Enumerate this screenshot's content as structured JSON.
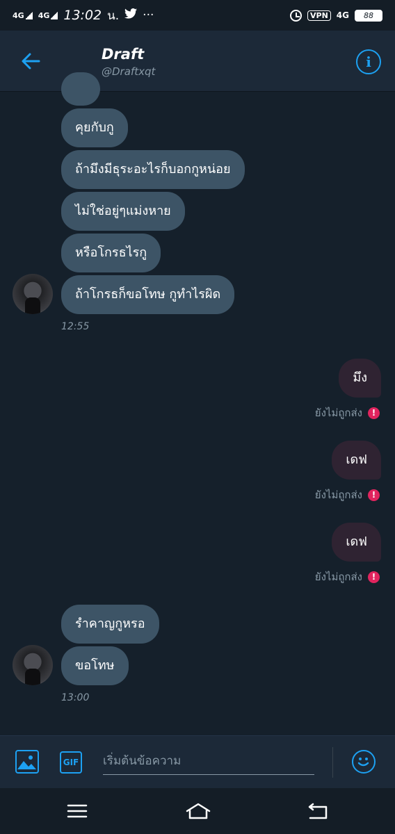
{
  "status_bar": {
    "signal_1": "4G",
    "signal_2": "4G",
    "time": "13:02",
    "carrier_suffix": "น.",
    "more": "···",
    "vpn": "VPN",
    "network": "4G",
    "battery": "88"
  },
  "header": {
    "title": "Draft",
    "handle": "@Draftxqt",
    "info_label": "i"
  },
  "messages": {
    "incoming_group_1": [
      "คุยกับกู",
      "ถ้ามึงมีธุระอะไรก็บอกกูหน่อย",
      "ไม่ใช่อยู่ๆแม่งหาย",
      "หรือโกรธไรกู",
      "ถ้าโกรธก็ขอโทษ กูทำไรผิด"
    ],
    "timestamp_1": "12:55",
    "outgoing": [
      {
        "text": "มึง",
        "status": "ยังไม่ถูกส่ง"
      },
      {
        "text": "เดฟ",
        "status": "ยังไม่ถูกส่ง"
      },
      {
        "text": "เดฟ",
        "status": "ยังไม่ถูกส่ง"
      }
    ],
    "incoming_group_2": [
      "รำคาญกูหรอ",
      "ขอโทษ"
    ],
    "timestamp_2": "13:00"
  },
  "composer": {
    "placeholder": "เริ่มต้นข้อความ",
    "gif_label": "GIF"
  },
  "colors": {
    "background": "#15202b",
    "incoming_bubble": "#3d5466",
    "outgoing_bubble": "#2f2332",
    "accent": "#1da1f2",
    "error": "#e0245e"
  }
}
